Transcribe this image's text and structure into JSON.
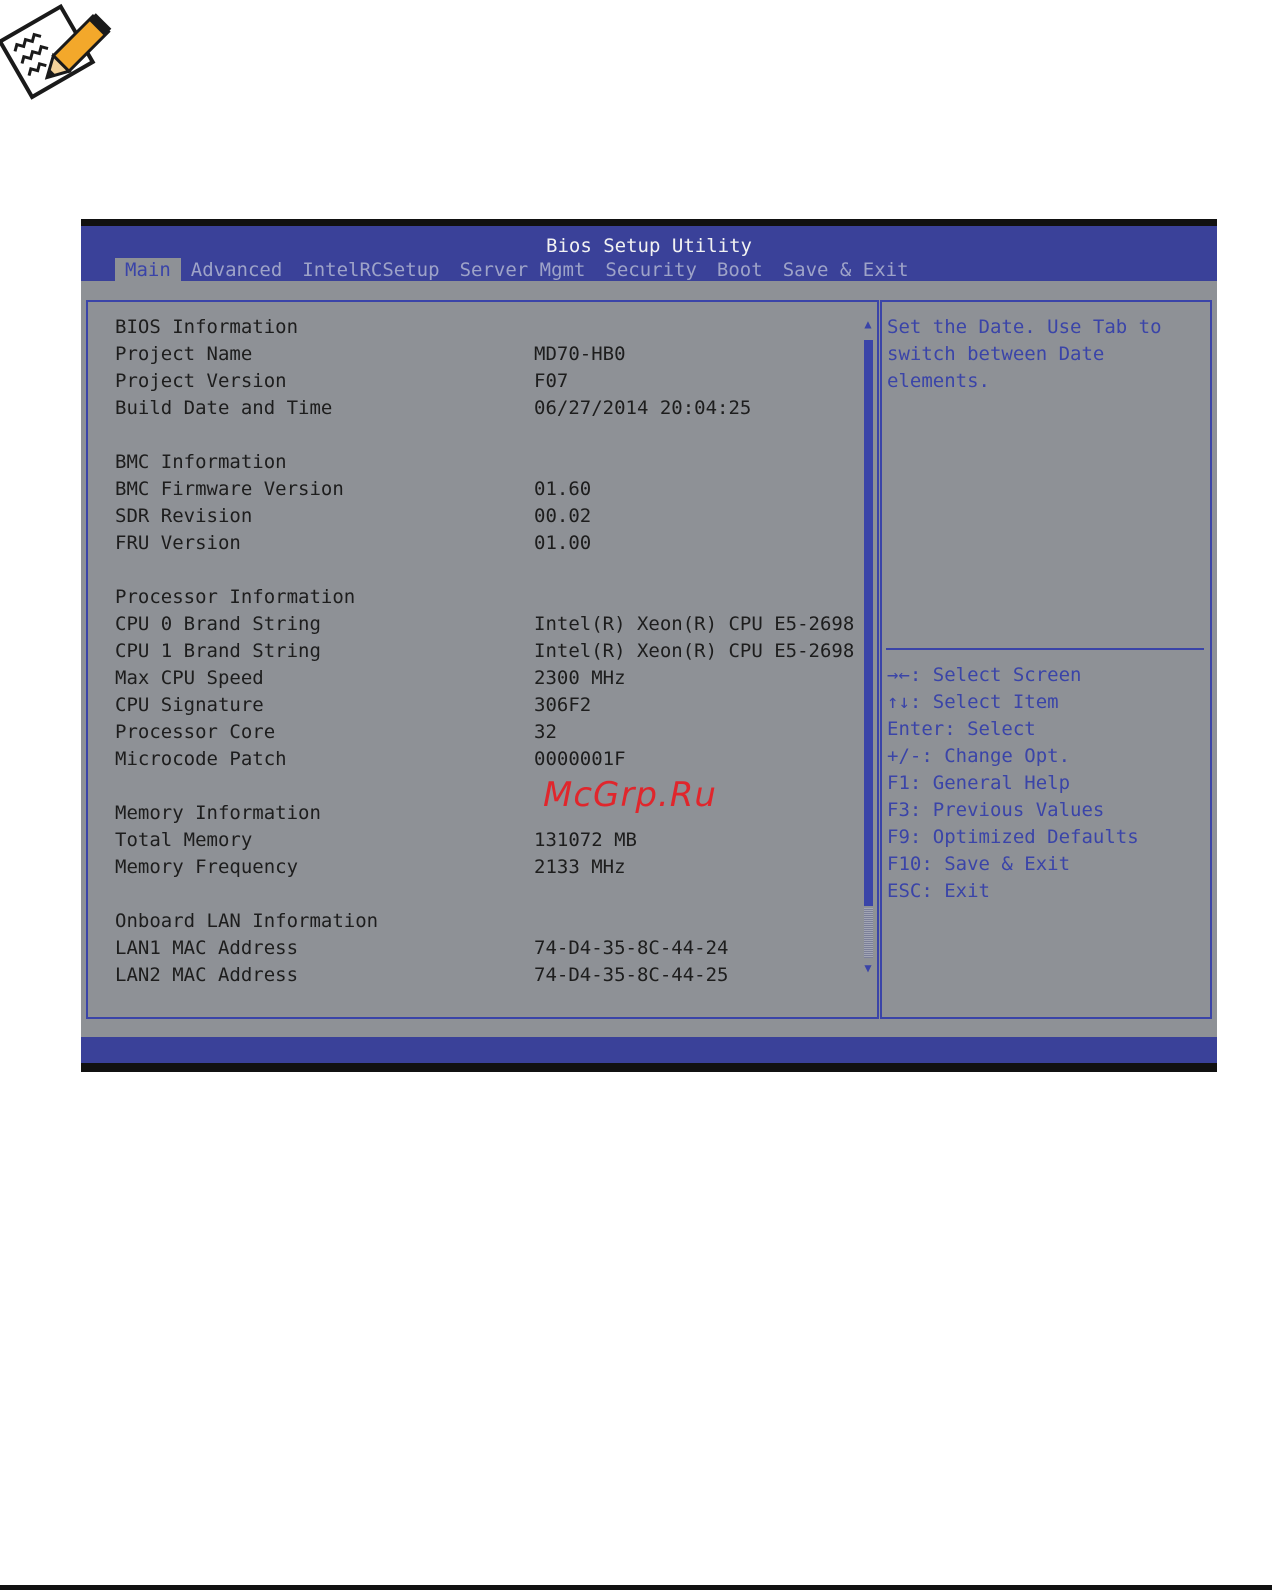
{
  "bios": {
    "title": "Bios Setup Utility",
    "tabs": [
      {
        "label": "Main",
        "active": true
      },
      {
        "label": "Advanced",
        "active": false
      },
      {
        "label": "IntelRCSetup",
        "active": false
      },
      {
        "label": "Server Mgmt",
        "active": false
      },
      {
        "label": "Security",
        "active": false
      },
      {
        "label": "Boot",
        "active": false
      },
      {
        "label": "Save & Exit",
        "active": false
      }
    ],
    "sections": [
      {
        "heading": "BIOS Information",
        "rows": [
          {
            "label": "Project Name",
            "value": "MD70-HB0"
          },
          {
            "label": "Project Version",
            "value": "F07"
          },
          {
            "label": "Build Date and Time",
            "value": "06/27/2014 20:04:25"
          }
        ]
      },
      {
        "heading": "BMC Information",
        "rows": [
          {
            "label": "BMC Firmware Version",
            "value": "01.60"
          },
          {
            "label": "SDR Revision",
            "value": "00.02"
          },
          {
            "label": "FRU Version",
            "value": "01.00"
          }
        ]
      },
      {
        "heading": "Processor Information",
        "rows": [
          {
            "label": "CPU 0 Brand String",
            "value": "Intel(R) Xeon(R) CPU E5-2698"
          },
          {
            "label": "CPU 1 Brand String",
            "value": "Intel(R) Xeon(R) CPU E5-2698"
          },
          {
            "label": "Max CPU Speed",
            "value": "2300 MHz"
          },
          {
            "label": "CPU Signature",
            "value": "306F2"
          },
          {
            "label": "Processor Core",
            "value": "32"
          },
          {
            "label": "Microcode Patch",
            "value": "0000001F"
          }
        ]
      },
      {
        "heading": "Memory Information",
        "rows": [
          {
            "label": "Total Memory",
            "value": "131072 MB"
          },
          {
            "label": "Memory Frequency",
            "value": "2133 MHz"
          }
        ]
      },
      {
        "heading": "Onboard LAN Information",
        "rows": [
          {
            "label": "LAN1 MAC Address",
            "value": "74-D4-35-8C-44-24"
          },
          {
            "label": "LAN2 MAC Address",
            "value": "74-D4-35-8C-44-25"
          }
        ]
      }
    ],
    "help": {
      "lines": [
        "Set the Date. Use Tab to",
        "switch between Date",
        "elements."
      ]
    },
    "keys": [
      "→←: Select Screen",
      "↑↓: Select Item",
      "Enter: Select",
      "+/-: Change Opt.",
      "F1: General Help",
      "F3: Previous Values",
      "F9: Optimized Defaults",
      "F10: Save & Exit",
      "ESC: Exit"
    ],
    "scroll": {
      "up": "▲",
      "down": "▼"
    },
    "colors": {
      "header": "#3a4199",
      "panel": "#8e9196",
      "accent": "#3a44a8"
    }
  },
  "watermark": "McGrp.Ru",
  "icon": "note-pencil-icon"
}
